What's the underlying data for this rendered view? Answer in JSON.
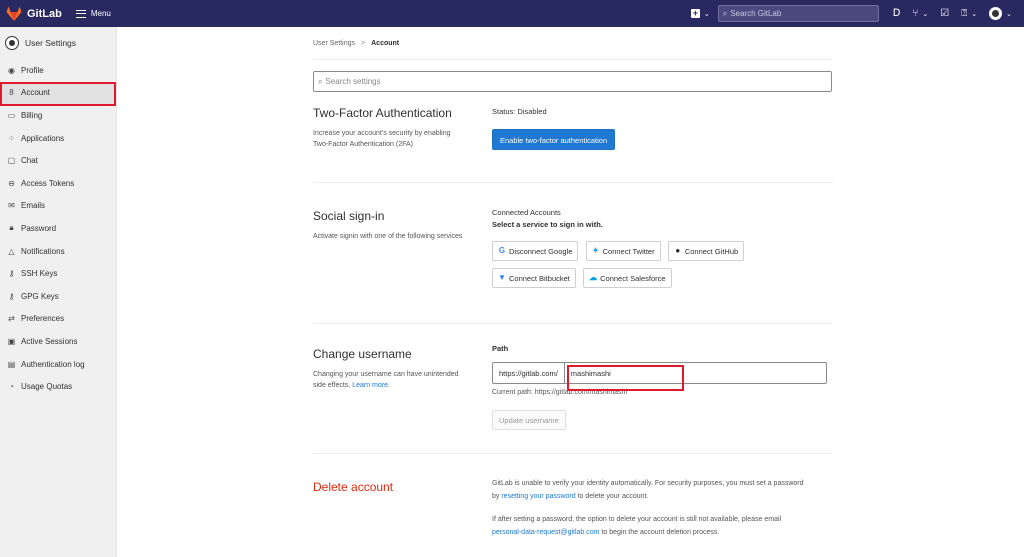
{
  "topbar": {
    "brand": "GitLab",
    "menu_label": "Menu",
    "search_placeholder": "Search GitLab",
    "icons": [
      "plus-square-icon",
      "search-icon",
      "issues-icon",
      "merge-request-icon",
      "todo-icon",
      "help-icon",
      "avatar-icon"
    ]
  },
  "sidebar": {
    "title": "User Settings",
    "items": [
      {
        "label": "Profile",
        "icon": "profile-icon"
      },
      {
        "label": "Account",
        "icon": "account-icon",
        "active": true
      },
      {
        "label": "Billing",
        "icon": "billing-icon"
      },
      {
        "label": "Applications",
        "icon": "applications-icon"
      },
      {
        "label": "Chat",
        "icon": "chat-icon"
      },
      {
        "label": "Access Tokens",
        "icon": "token-icon"
      },
      {
        "label": "Emails",
        "icon": "email-icon"
      },
      {
        "label": "Password",
        "icon": "lock-icon"
      },
      {
        "label": "Notifications",
        "icon": "bell-icon"
      },
      {
        "label": "SSH Keys",
        "icon": "key-icon"
      },
      {
        "label": "GPG Keys",
        "icon": "key-icon"
      },
      {
        "label": "Preferences",
        "icon": "preferences-icon"
      },
      {
        "label": "Active Sessions",
        "icon": "monitor-icon"
      },
      {
        "label": "Authentication log",
        "icon": "log-icon"
      },
      {
        "label": "Usage Quotas",
        "icon": "quota-icon"
      }
    ]
  },
  "breadcrumb": {
    "parent": "User Settings",
    "separator": ">",
    "current": "Account"
  },
  "settings_search_placeholder": "Search settings",
  "two_factor": {
    "title": "Two-Factor Authentication",
    "desc_line1": "Increase your account's security by enabling",
    "desc_line2": "Two-Factor Authentication (2FA)",
    "status": "Status: Disabled",
    "button": "Enable two-factor authentication"
  },
  "social": {
    "title": "Social sign-in",
    "desc": "Activate signin with one of the following services",
    "connected_label": "Connected Accounts",
    "select_label": "Select a service to sign in with.",
    "buttons": [
      "Disconnect Google",
      "Connect Twitter",
      "Connect GitHub",
      "Connect Bitbucket",
      "Connect Salesforce"
    ]
  },
  "username": {
    "title": "Change username",
    "desc_line1": "Changing your username can have unintended",
    "desc_line2_prefix": "side effects.",
    "learn_more": "Learn more",
    "desc_line2_suffix": ".",
    "path_label": "Path",
    "prefix": "https://gitlab.com/",
    "value": "mashimashi",
    "current_path": "Current path: https://gitlab.com/mashimashi",
    "update_button": "Update username"
  },
  "delete": {
    "title": "Delete account",
    "p1_part1": "GitLab is unable to verify your identity automatically. For security purposes, you must set a password",
    "p1_by": "by ",
    "p1_link": "resetting your password",
    "p1_part2": " to delete your account.",
    "p2_part1": "If after setting a password, the option to delete your account is still not available, please email",
    "p2_link": "personal-data-request@gitlab.com",
    "p2_part2": " to begin the account deletion process."
  }
}
